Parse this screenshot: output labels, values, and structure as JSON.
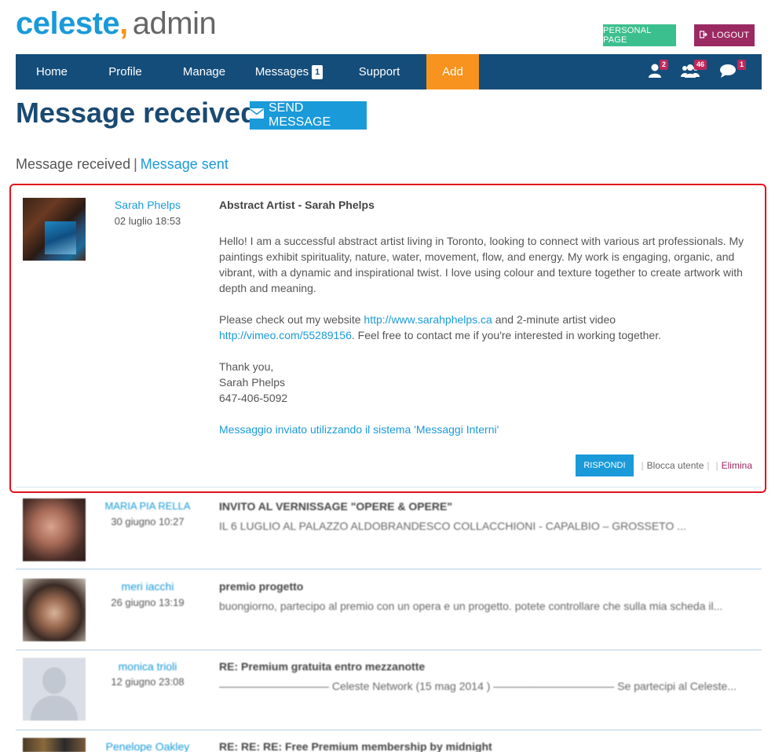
{
  "header": {
    "brand": "celeste",
    "comma": ",",
    "suffix": "admin",
    "personal_page": "PERSONAL PAGE",
    "logout": "LOGOUT"
  },
  "nav": {
    "items": [
      {
        "label": "Home"
      },
      {
        "label": "Profile"
      },
      {
        "label": "Manage"
      },
      {
        "label": "Messages",
        "badge": "1"
      },
      {
        "label": "Support"
      },
      {
        "label": "Add"
      }
    ],
    "icons": [
      {
        "name": "user-icon",
        "badge": "2"
      },
      {
        "name": "users-icon",
        "badge": "46"
      },
      {
        "name": "chat-icon",
        "badge": "1"
      }
    ]
  },
  "page": {
    "title": "Message received",
    "send_button": "SEND MESSAGE",
    "subnav_current": "Message received",
    "subnav_separator": "|",
    "subnav_link": "Message sent"
  },
  "open_message": {
    "sender": "Sarah Phelps",
    "date": "02 luglio 18:53",
    "subject": "Abstract Artist - Sarah Phelps",
    "paragraph1": "Hello! I am a successful abstract artist living in Toronto, looking to connect with various art professionals. My paintings exhibit spirituality, nature, water, movement, flow, and energy. My work is engaging, organic, and vibrant, with a dynamic and inspirational twist. I love using colour and texture together to create artwork with depth and meaning.",
    "p2_before": "Please check out my website ",
    "p2_link1": "http://www.sarahphelps.ca",
    "p2_middle": " and 2-minute artist video ",
    "p2_link2": "http://vimeo.com/55289156",
    "p2_after": ". Feel free to contact me if you're interested in working together.",
    "closing1": "Thank you,",
    "closing2": "Sarah Phelps",
    "closing3": "647-406-5092",
    "system_note": "Messaggio inviato utilizzando il sistema 'Messaggi Interni'",
    "reply": "RISPONDI",
    "block": "Blocca utente",
    "delete": "Elimina",
    "sep": "|"
  },
  "messages": [
    {
      "sender": "MARIA PIA RELLA",
      "date": "30 giugno 10:27",
      "subject": "INVITO AL VERNISSAGE \"OPERE & OPERE\"",
      "preview": "IL 6 LUGLIO AL PALAZZO ALDOBRANDESCO COLLACCHIONI - CAPALBIO – GROSSETO ..."
    },
    {
      "sender": "meri iacchi",
      "date": "26 giugno 13:19",
      "subject": "premio progetto",
      "preview": "buongiorno, partecipo al premio con un opera e un progetto. potete controllare che sulla mia scheda il..."
    },
    {
      "sender": "monica trioli",
      "date": "12 giugno 23:08",
      "subject": "RE: Premium gratuita entro mezzanotte",
      "preview": "—————————— Celeste Network (15 mag 2014 ) ——————————— Se partecipi al Celeste..."
    },
    {
      "sender": "Penelope Oakley",
      "date": "",
      "subject": "RE: RE: RE: Free Premium membership by midnight",
      "preview": ""
    }
  ]
}
